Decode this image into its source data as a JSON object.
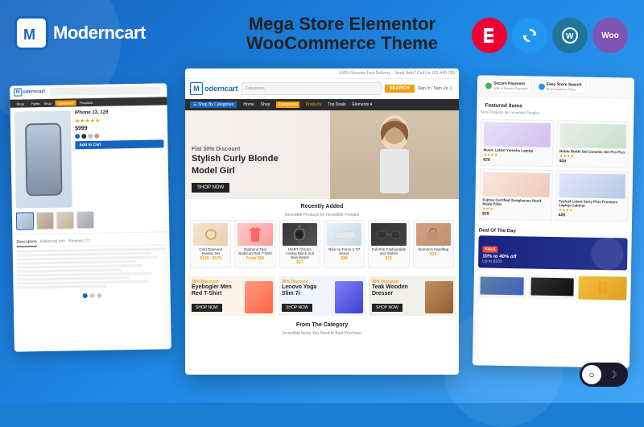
{
  "brand": {
    "logo_letter": "M",
    "name": "Moderncart",
    "tagline_line1": "Mega Store Elementor",
    "tagline_line2": "WooCommerce Theme"
  },
  "plugins": [
    {
      "name": "Elementor",
      "letter": "E",
      "color": "#ee0033"
    },
    {
      "name": "Rotate/Update",
      "letter": "↻",
      "color": "#2196f3"
    },
    {
      "name": "WordPress",
      "letter": "W",
      "color": "#21759b"
    },
    {
      "name": "WooCommerce",
      "letter": "Woo",
      "color": "#7f54b3"
    }
  ],
  "center_mockup": {
    "hero": {
      "discount": "Flat 30% Discount",
      "title_line1": "Stylish Curly Blonde",
      "title_line2": "Model Girl",
      "cta": "SHOP NOW"
    },
    "recently_added": {
      "title": "Recently Added",
      "subtitle": "Incredible Products for Incredible Peoples"
    },
    "promo_cards": [
      {
        "discount": "35% Discount",
        "title": "Eyebogler Men\nRed T-Shirt",
        "cta": "SHOP NOW"
      },
      {
        "discount": "30% Discount",
        "title": "Lenovo Yoga\nSlim 7i",
        "cta": "SHOP NOW"
      },
      {
        "discount": "36% Discount",
        "title": "Teak Wooden\nDresser",
        "cta": "SHOP NOW"
      }
    ],
    "from_category": {
      "title": "From The Category",
      "subtitle": "Incredible Items You Need to Best Purchase"
    }
  },
  "left_mockup": {
    "product": {
      "title": "iPhone 13, 128",
      "price": "$999",
      "stars": "★★★★★",
      "description_tabs": [
        "Description",
        "Additional Information",
        "Reviews (7)"
      ]
    }
  },
  "right_mockup": {
    "badges": [
      {
        "label": "Secure Payment",
        "sub": "Safe & Secure Payment"
      },
      {
        "label": "Easy Store Search",
        "sub": "Best Locations Store"
      }
    ],
    "featured_items": {
      "title": "Featured Items",
      "subtitle": "Nice Products for Incredible Peoples"
    },
    "deal_of_day": {
      "label": "Deal Of The Day",
      "discount": "10% to 40% off",
      "description": "Up to $100"
    }
  },
  "dark_mode": {
    "light_icon": "○",
    "dark_icon": "☽"
  }
}
